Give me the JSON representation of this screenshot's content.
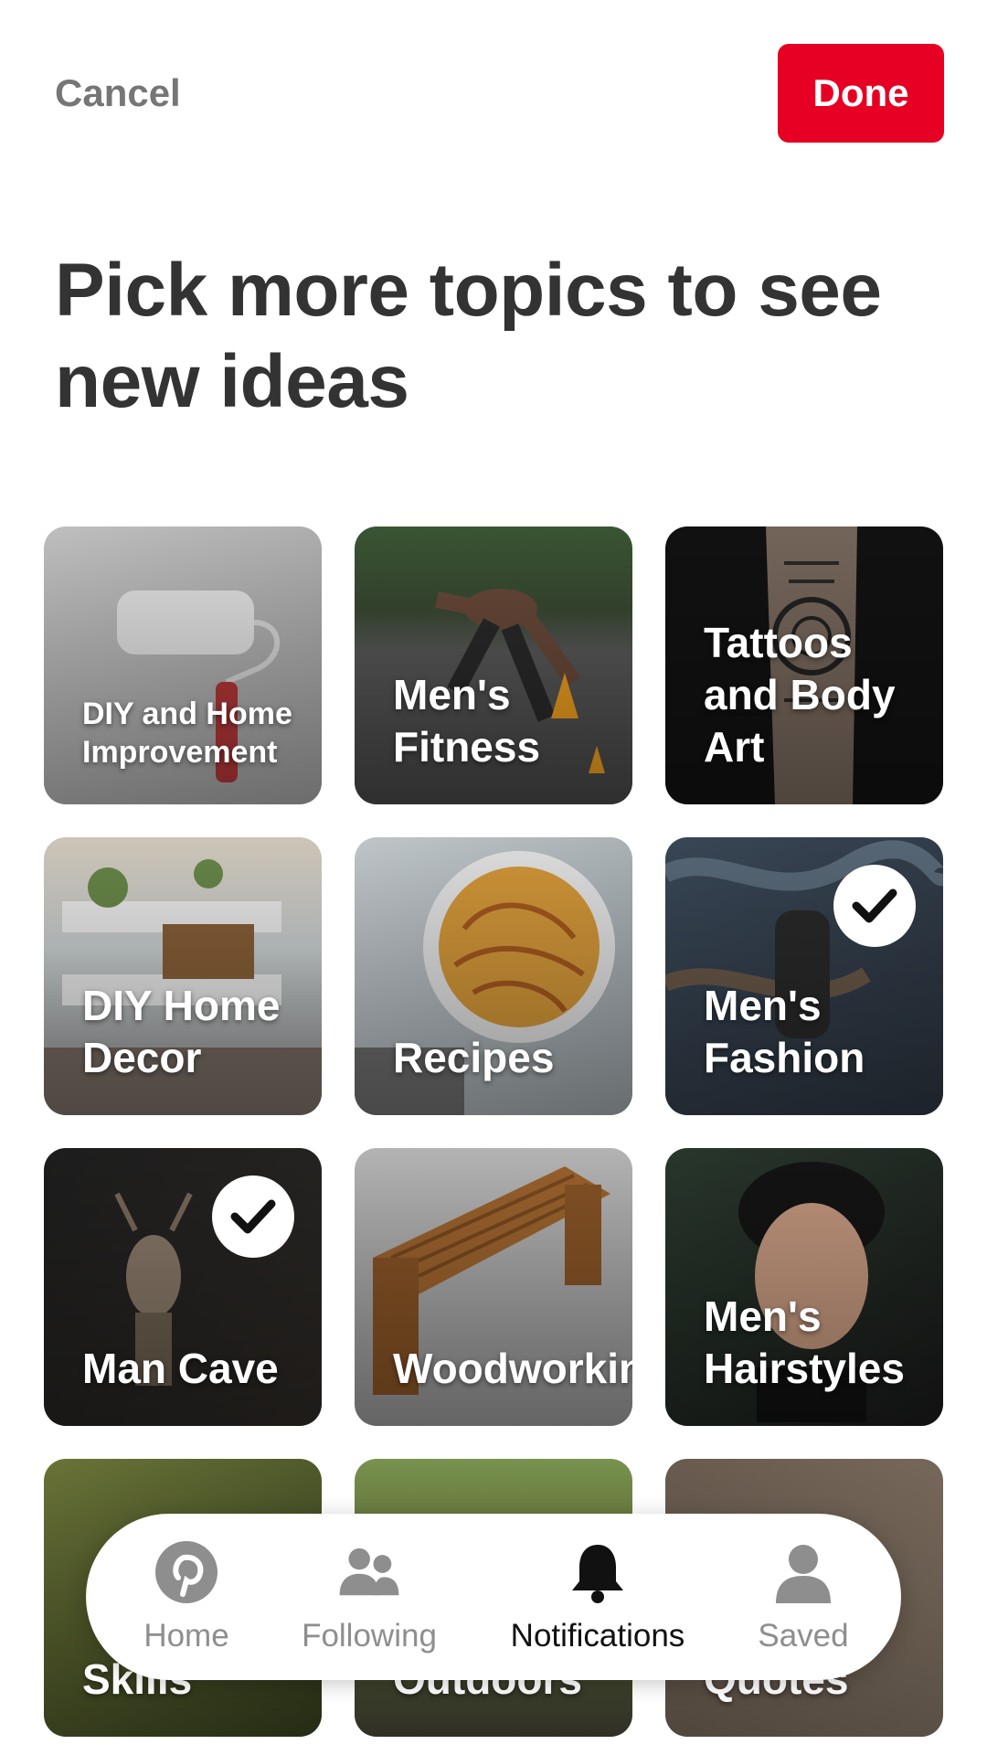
{
  "header": {
    "cancel_label": "Cancel",
    "done_label": "Done"
  },
  "title": "Pick more topics to see new ideas",
  "colors": {
    "accent": "#e60023",
    "nav_inactive": "#8e8e8e",
    "nav_active": "#111111"
  },
  "topics": [
    {
      "label": "DIY and Home Improvement",
      "selected": false
    },
    {
      "label": "Men's Fitness",
      "selected": false
    },
    {
      "label": "Tattoos and Body Art",
      "selected": false
    },
    {
      "label": "DIY Home Decor",
      "selected": false
    },
    {
      "label": "Recipes",
      "selected": false
    },
    {
      "label": "Men's Fashion",
      "selected": true
    },
    {
      "label": "Man Cave",
      "selected": true
    },
    {
      "label": "Woodworking",
      "selected": false
    },
    {
      "label": "Men's Hairstyles",
      "selected": false
    },
    {
      "label": "Skills",
      "selected": false
    },
    {
      "label": "Outdoors",
      "selected": false
    },
    {
      "label": "Quotes",
      "selected": false
    }
  ],
  "nav": [
    {
      "label": "Home",
      "icon": "pinterest-logo-icon",
      "active": false
    },
    {
      "label": "Following",
      "icon": "people-icon",
      "active": false
    },
    {
      "label": "Notifications",
      "icon": "bell-icon",
      "active": true
    },
    {
      "label": "Saved",
      "icon": "person-icon",
      "active": false
    }
  ]
}
